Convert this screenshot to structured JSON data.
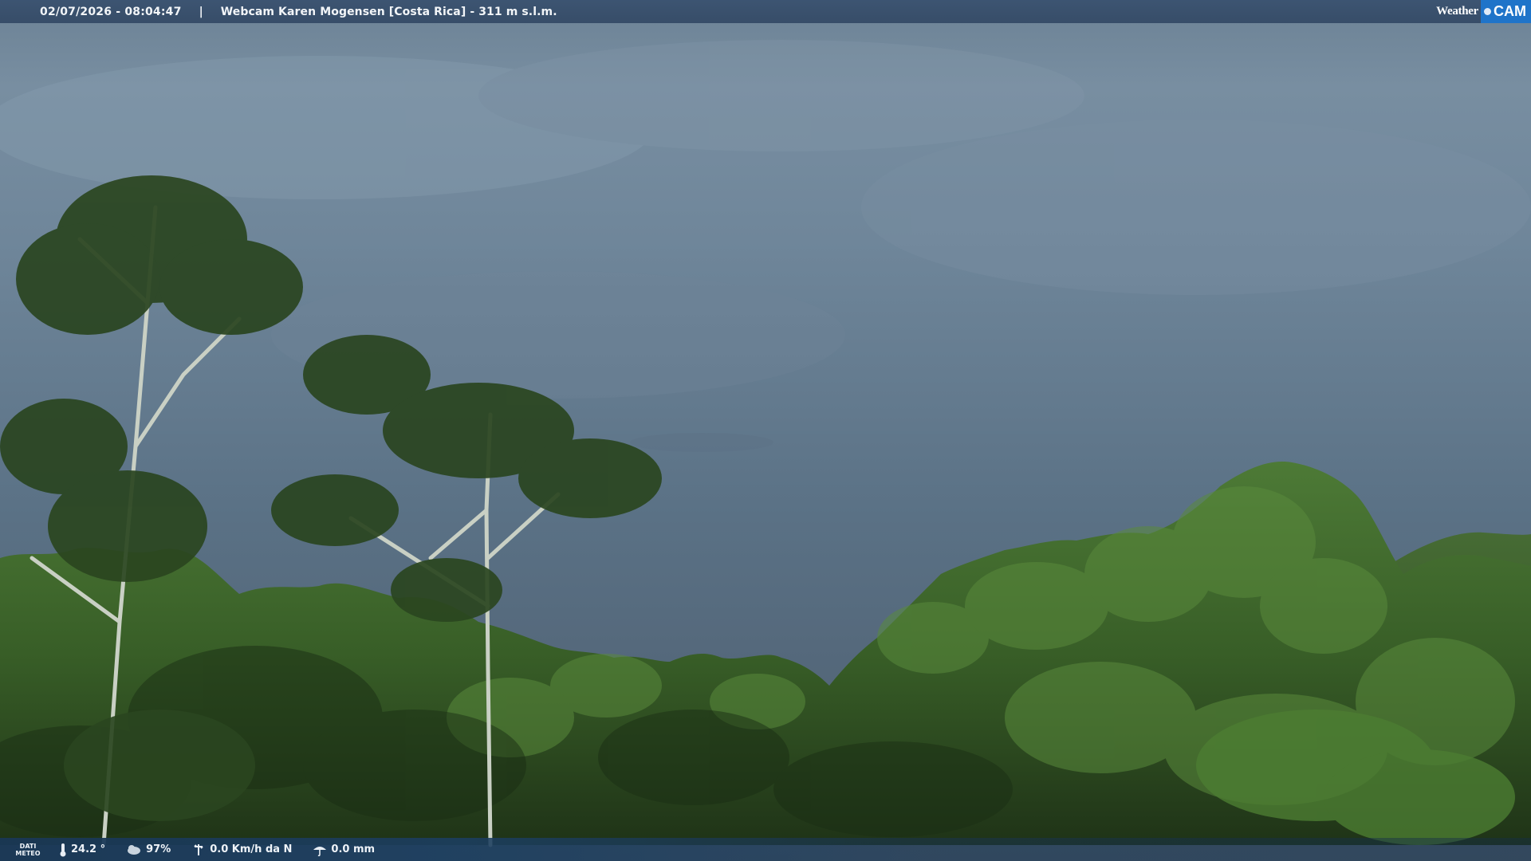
{
  "header": {
    "datetime": "02/07/2026 - 08:04:47",
    "separator": "|",
    "title": "Webcam Karen Mogensen [Costa Rica]  - 311 m s.l.m."
  },
  "logo": {
    "left": "Weather",
    "right": "CAM"
  },
  "footer": {
    "label_line1": "DATI",
    "label_line2": "METEO",
    "temperature": "24.2 °",
    "humidity": "97%",
    "wind": "0.0 Km/h da N",
    "rain": "0.0 mm"
  },
  "colors": {
    "sky": "#6f869a",
    "foliage": "#2f4a22",
    "bar": "#334e6e",
    "logo_accent": "#1f74c9"
  }
}
